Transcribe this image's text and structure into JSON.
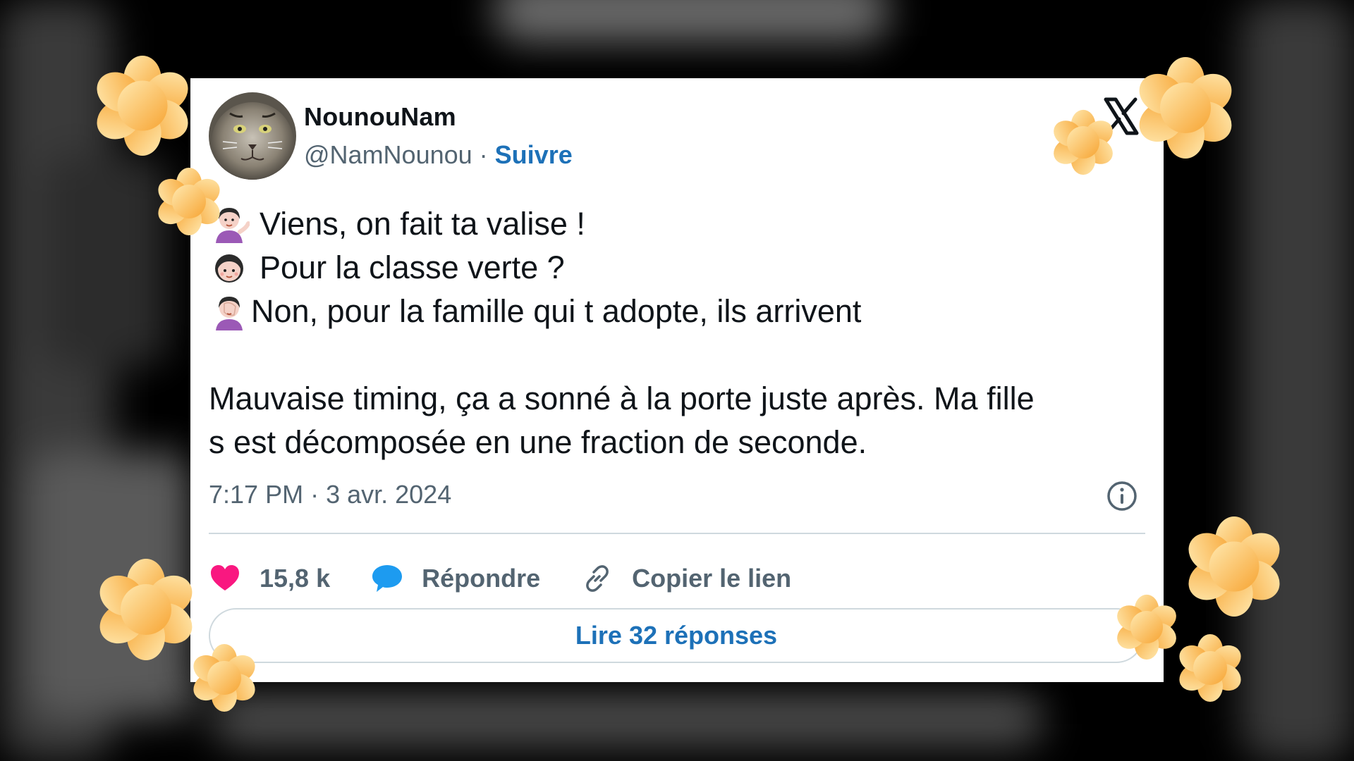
{
  "tweet": {
    "display_name": "NounouNam",
    "handle": "@NamNounou",
    "separator": " · ",
    "follow_label": "Suivre",
    "lines": [
      "Viens, on fait ta valise !",
      "Pour la classe verte ?",
      "Non, pour la famille qui t adopte, ils arrivent"
    ],
    "paragraph": [
      "Mauvaise timing, ça a sonné à la porte juste après. Ma fille",
      "s est décomposée en une fraction de seconde."
    ],
    "time": "7:17 PM",
    "date": "3 avr. 2024",
    "meta_separator": " · ",
    "likes": "15,8 k",
    "reply_label": "Répondre",
    "copy_link_label": "Copier le lien",
    "read_replies_label": "Lire 32 réponses"
  },
  "icons": {
    "logo": "x-logo-icon",
    "info": "info-icon",
    "like": "heart-icon",
    "reply": "speech-bubble-icon",
    "copy": "link-icon",
    "emoji_1": "woman-tipping-hand-emoji",
    "emoji_2": "woman-emoji",
    "emoji_3": "woman-facepalming-emoji"
  },
  "colors": {
    "link_blue": "#1d71b8",
    "heart": "#f91880",
    "reply_bubble": "#1d9bf0",
    "flower_light": "#ffe5a8",
    "flower_dark": "#f9a93a"
  }
}
